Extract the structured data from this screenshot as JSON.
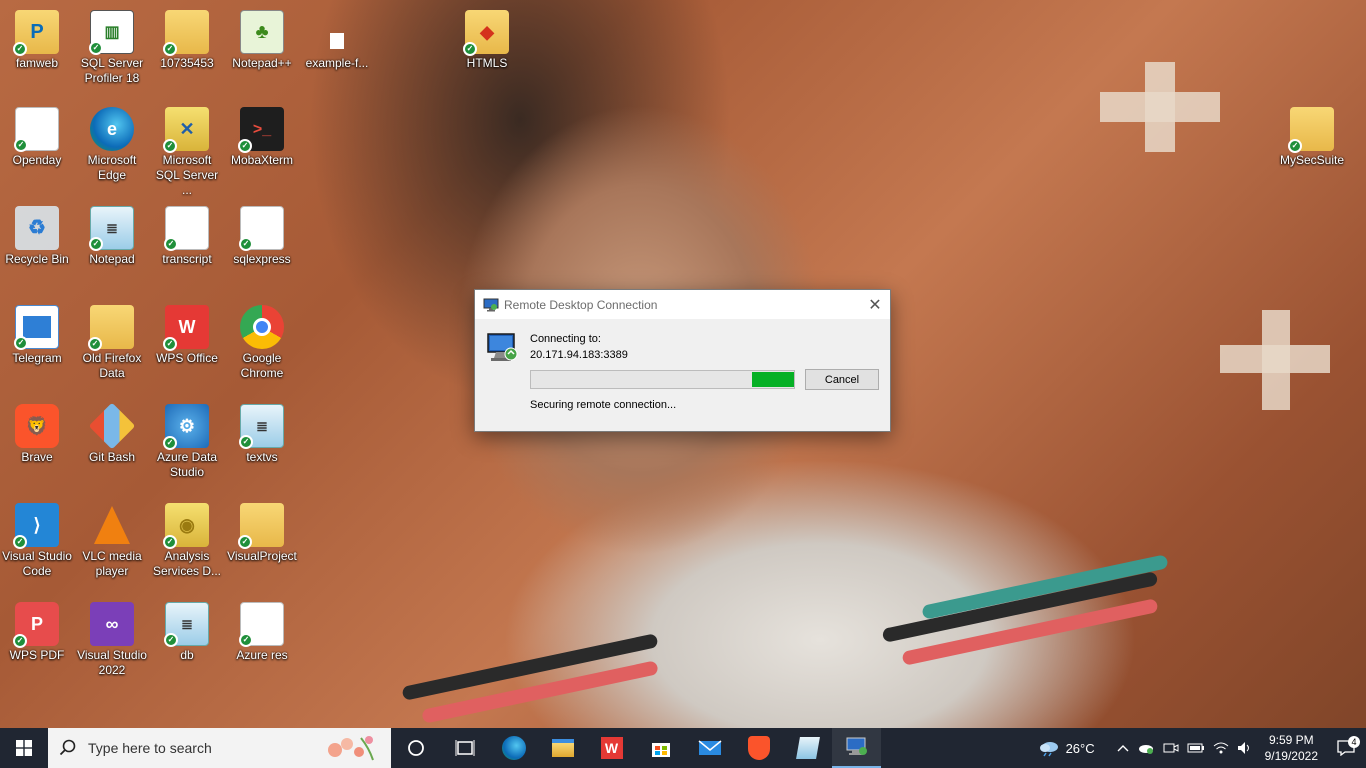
{
  "desktop": {
    "icons": [
      {
        "label": "famweb",
        "icon": "onenote-folder-icon"
      },
      {
        "label": "SQL Server Profiler 18",
        "icon": "sql-profiler-icon"
      },
      {
        "label": "10735453",
        "icon": "folder-icon"
      },
      {
        "label": "Notepad++",
        "icon": "notepadpp-icon"
      },
      {
        "label": "example-f...",
        "icon": "file-icon"
      },
      {
        "label": "HTMLS",
        "icon": "html-folder-icon"
      },
      {
        "label": "Openday",
        "icon": "document-icon"
      },
      {
        "label": "Microsoft Edge",
        "icon": "edge-icon"
      },
      {
        "label": "Microsoft SQL Server ...",
        "icon": "sql-server-icon"
      },
      {
        "label": "MobaXterm",
        "icon": "mobaxterm-icon"
      },
      {
        "label": "MySecSuite",
        "icon": "folder-icon"
      },
      {
        "label": "Recycle Bin",
        "icon": "recycle-bin-icon"
      },
      {
        "label": "Notepad",
        "icon": "notepad-icon"
      },
      {
        "label": "transcript",
        "icon": "document-icon"
      },
      {
        "label": "sqlexpress",
        "icon": "document-icon"
      },
      {
        "label": "Telegram",
        "icon": "telegram-icon"
      },
      {
        "label": "Old Firefox Data",
        "icon": "folder-icon"
      },
      {
        "label": "WPS Office",
        "icon": "wps-office-icon"
      },
      {
        "label": "Google Chrome",
        "icon": "chrome-icon"
      },
      {
        "label": "Brave",
        "icon": "brave-icon"
      },
      {
        "label": "Git Bash",
        "icon": "git-bash-icon"
      },
      {
        "label": "Azure Data Studio",
        "icon": "azure-data-studio-icon"
      },
      {
        "label": "textvs",
        "icon": "notepad-icon"
      },
      {
        "label": "Visual Studio Code",
        "icon": "vscode-icon"
      },
      {
        "label": "VLC media player",
        "icon": "vlc-icon"
      },
      {
        "label": "Analysis Services D...",
        "icon": "analysis-services-icon"
      },
      {
        "label": "VisualProject",
        "icon": "folder-icon"
      },
      {
        "label": "WPS PDF",
        "icon": "wps-pdf-icon"
      },
      {
        "label": "Visual Studio 2022",
        "icon": "visual-studio-icon"
      },
      {
        "label": "db",
        "icon": "notepad-icon"
      },
      {
        "label": "Azure res",
        "icon": "document-icon"
      }
    ]
  },
  "dialog": {
    "title": "Remote Desktop Connection",
    "connecting_label": "Connecting to:",
    "address": "20.171.94.183:3389",
    "progress_segment_start": 0.84,
    "progress_segment_width": 0.16,
    "cancel_label": "Cancel",
    "status": "Securing remote connection...",
    "close_glyph": "✕"
  },
  "taskbar": {
    "search_placeholder": "Type here to search",
    "weather_temp": "26°C",
    "time": "9:59 PM",
    "date": "9/19/2022",
    "notification_count": "4",
    "accent": "#06b025"
  }
}
